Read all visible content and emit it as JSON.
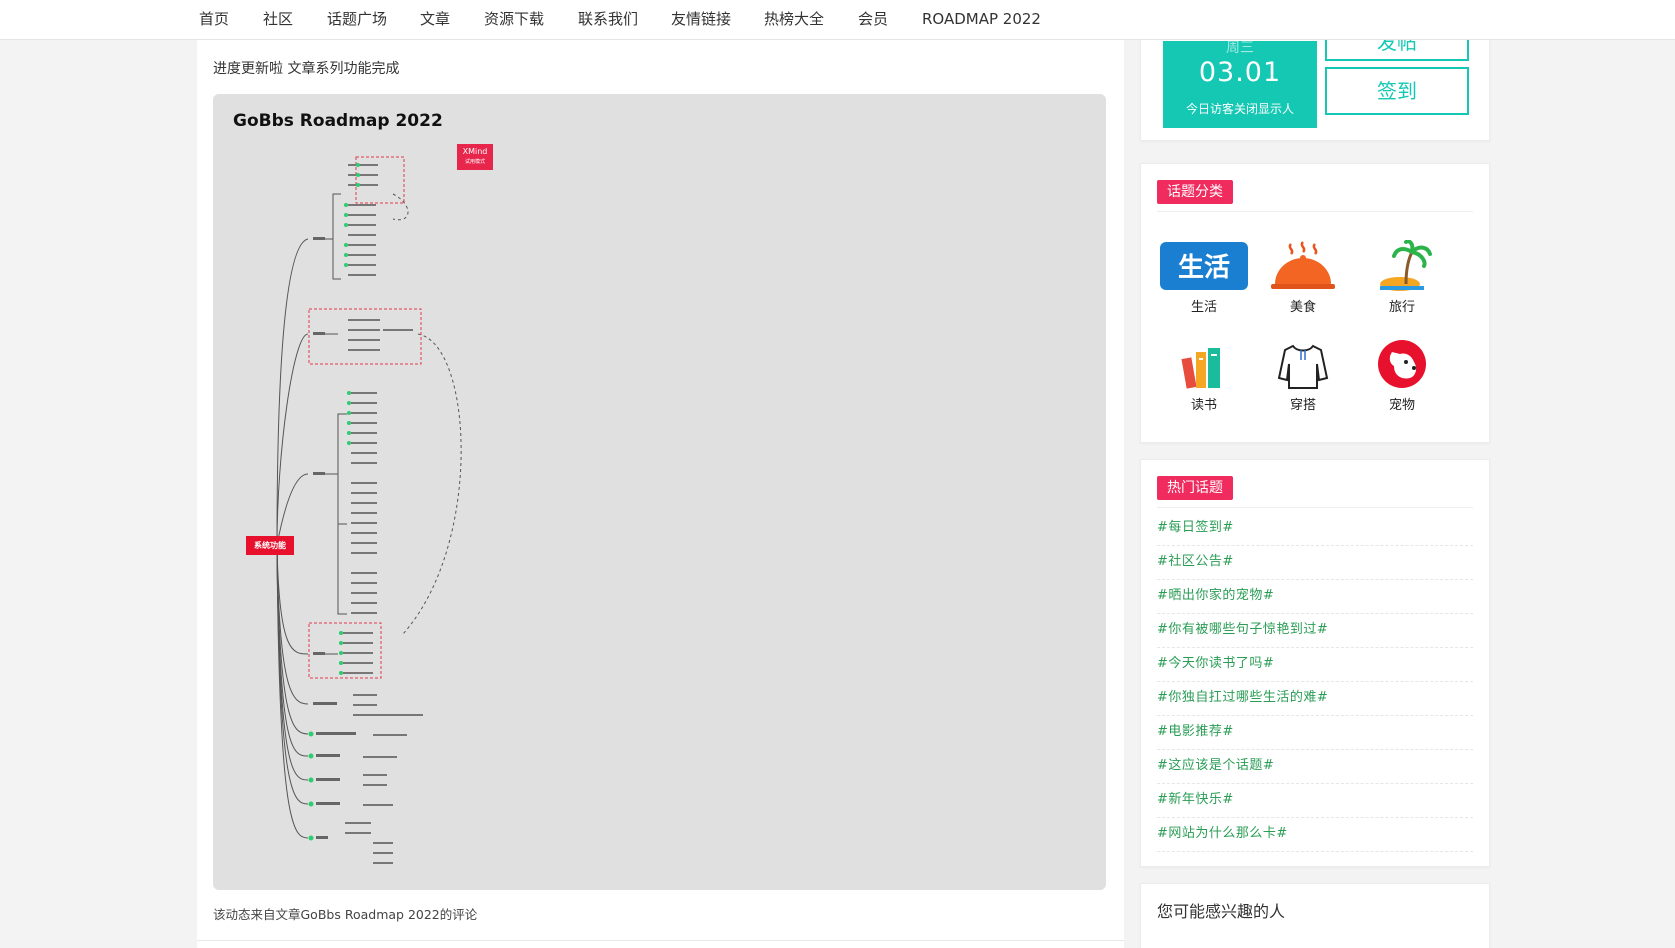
{
  "nav": [
    "首页",
    "社区",
    "话题广场",
    "文章",
    "资源下载",
    "联系我们",
    "友情链接",
    "热榜大全",
    "会员",
    "ROADMAP 2022"
  ],
  "post": {
    "text": "进度更新啦 文章系列功能完成",
    "image_title": "GoBbs Roadmap 2022",
    "xmind_badge": "XMind",
    "xmind_badge_sub": "试用模式",
    "root_node": "系统功能",
    "source": "该动态来自文章GoBbs Roadmap 2022的评论"
  },
  "signin": {
    "weekday": "周三",
    "date": "03.01",
    "note": "今日访客关闭显示人",
    "post_button": "发帖",
    "signin_button": "签到"
  },
  "topics": {
    "title": "话题分类",
    "items": [
      {
        "label": "生活",
        "icon": "life-badge-icon"
      },
      {
        "label": "美食",
        "icon": "food-cloche-icon"
      },
      {
        "label": "旅行",
        "icon": "palm-island-icon"
      },
      {
        "label": "读书",
        "icon": "books-icon"
      },
      {
        "label": "穿搭",
        "icon": "shirt-icon"
      },
      {
        "label": "宠物",
        "icon": "dog-icon"
      }
    ],
    "life_icon_text": "生活"
  },
  "hot": {
    "title": "热门话题",
    "items": [
      "#每日签到#",
      "#社区公告#",
      "#晒出你家的宠物#",
      "#你有被哪些句子惊艳到过#",
      "#今天你读书了吗#",
      "#你独自扛过哪些生活的难#",
      "#电影推荐#",
      "#这应该是个话题#",
      "#新年快乐#",
      "#网站为什么那么卡#"
    ]
  },
  "people": {
    "title": "您可能感兴趣的人"
  },
  "colors": {
    "accent": "#14c8b4",
    "tag": "#f02b5e",
    "hot_link": "#2a9d55",
    "mindmap_root": "#e8112d"
  }
}
